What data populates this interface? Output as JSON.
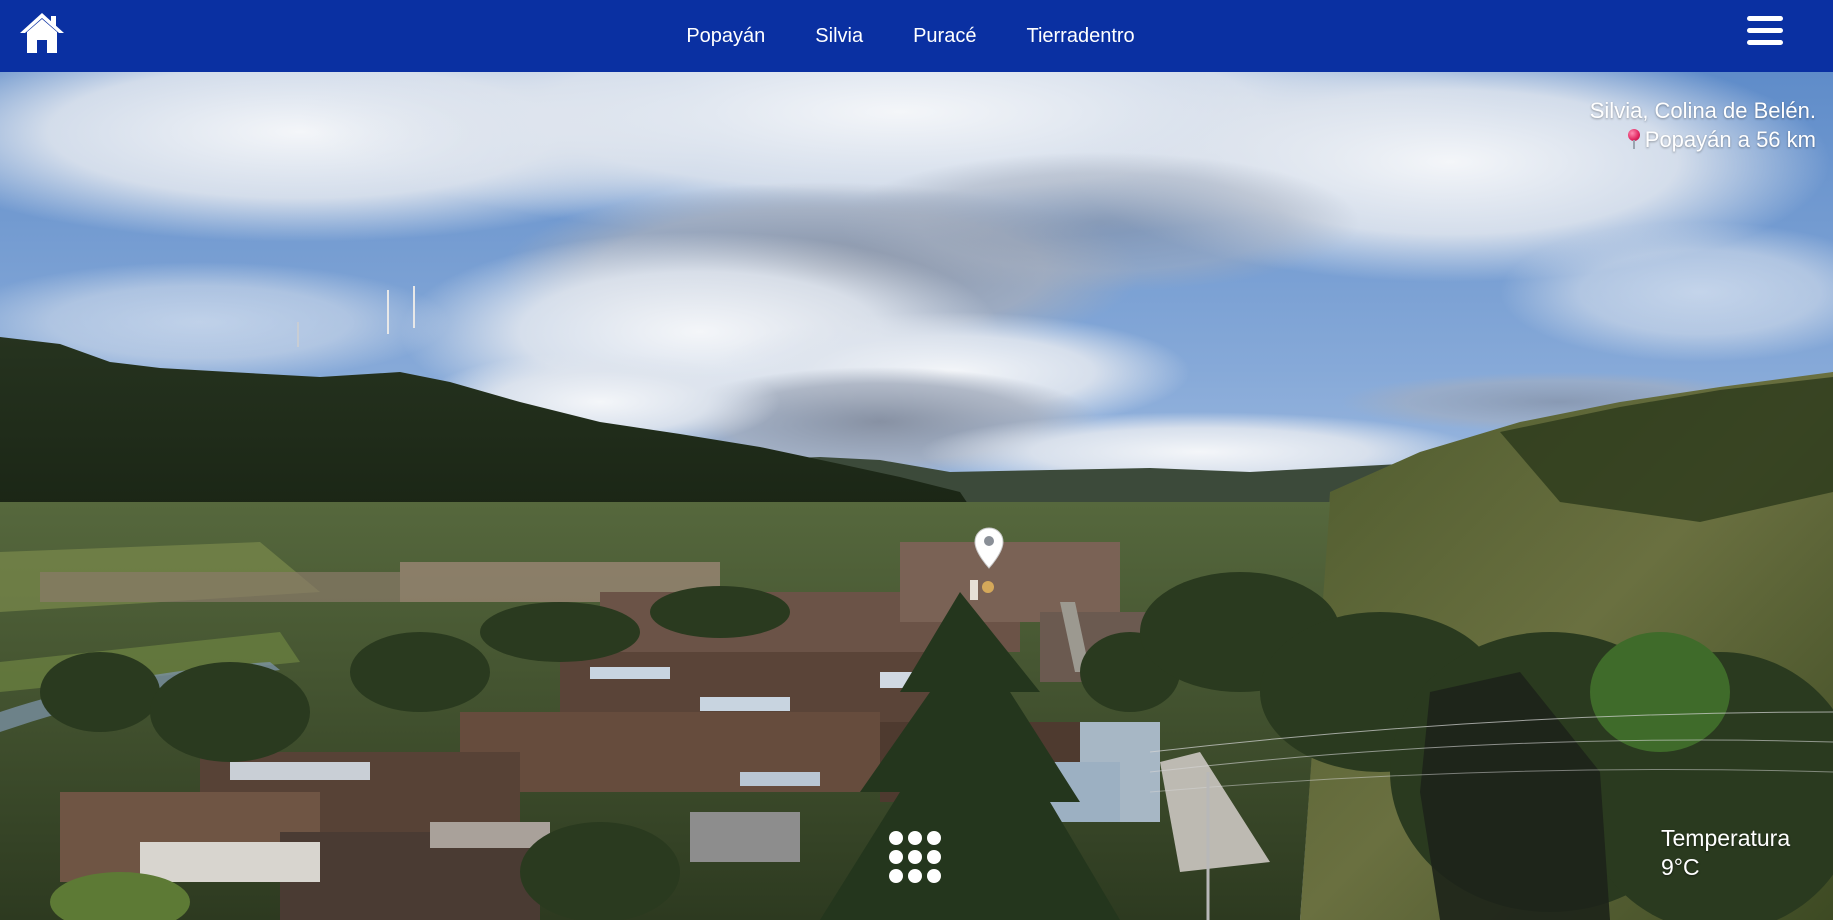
{
  "nav": {
    "home_icon": "home-icon",
    "links": [
      {
        "label": "Popayán"
      },
      {
        "label": "Silvia"
      },
      {
        "label": "Puracé"
      },
      {
        "label": "Tierradentro"
      }
    ],
    "menu_icon": "hamburger-menu-icon",
    "background_color": "#0a30a2"
  },
  "location": {
    "title": "Silvia, Colina de Belén.",
    "distance": "Popayán a 56 km",
    "distance_icon": "round-pushpin-icon"
  },
  "hotspot": {
    "icon": "map-pin-icon"
  },
  "gallery_button": {
    "icon": "grid-dots-icon"
  },
  "weather": {
    "label": "Temperatura",
    "value": "9°C"
  }
}
